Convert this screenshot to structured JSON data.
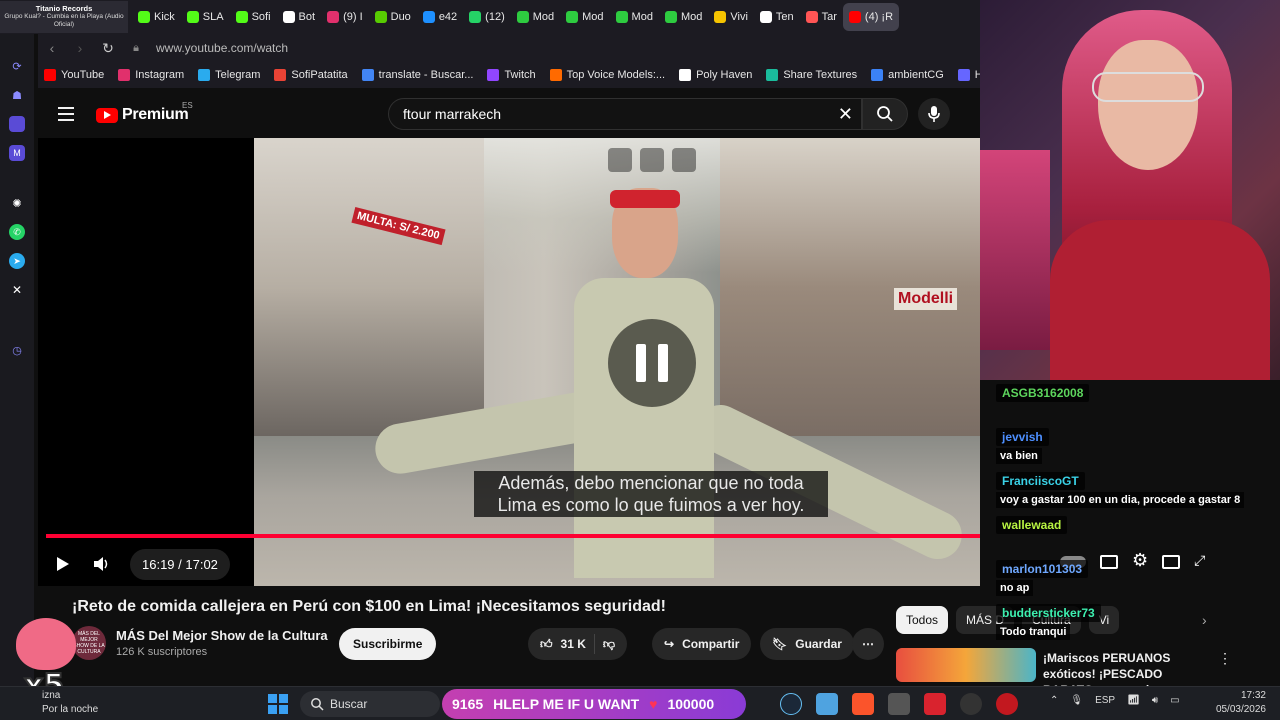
{
  "browser": {
    "first_tab": {
      "title": "Titanio Records",
      "subtitle": "Grupo Kual? - Cumbia en la Playa (Audio Oficial)"
    },
    "tabs": [
      {
        "label": "Kick",
        "color": "#53fc18"
      },
      {
        "label": "SLA",
        "color": "#53fc18"
      },
      {
        "label": "Sofi",
        "color": "#53fc18"
      },
      {
        "label": "Bot",
        "color": "#ffffff"
      },
      {
        "label": "(9) I",
        "color": "#e1306c"
      },
      {
        "label": "Duo",
        "color": "#58cc02"
      },
      {
        "label": "e42",
        "color": "#1e90ff"
      },
      {
        "label": "(12)",
        "color": "#25d366"
      },
      {
        "label": "Mod",
        "color": "#2ecc40"
      },
      {
        "label": "Mod",
        "color": "#2ecc40"
      },
      {
        "label": "Mod",
        "color": "#2ecc40"
      },
      {
        "label": "Mod",
        "color": "#2ecc40"
      },
      {
        "label": "Vivi",
        "color": "#f5c400"
      },
      {
        "label": "Ten",
        "color": "#ffffff"
      },
      {
        "label": "Tar",
        "color": "#ff5555"
      },
      {
        "label": "(4) ¡R",
        "color": "#ff0000"
      }
    ],
    "url": "www.youtube.com/watch",
    "bookmarks": [
      {
        "label": "YouTube",
        "color": "#ff0000"
      },
      {
        "label": "Instagram",
        "color": "#e1306c"
      },
      {
        "label": "Telegram",
        "color": "#2aabee"
      },
      {
        "label": "SofiPatatita",
        "color": "#ea4335"
      },
      {
        "label": "translate - Buscar...",
        "color": "#4285f4"
      },
      {
        "label": "Twitch",
        "color": "#9146ff"
      },
      {
        "label": "Top Voice Models:...",
        "color": "#ff6a00"
      },
      {
        "label": "Poly Haven",
        "color": "#ffffff"
      },
      {
        "label": "Share Textures",
        "color": "#1abc9c"
      },
      {
        "label": "ambientCG",
        "color": "#3b82f6"
      },
      {
        "label": "Ha",
        "color": "#6666ff"
      }
    ]
  },
  "youtube": {
    "logo": "Premium",
    "region": "ES",
    "search_value": "ftour marrakech",
    "player": {
      "subtitle_line1": "Además, debo mencionar que no toda",
      "subtitle_line2": "Lima es como lo que fuimos a ver hoy.",
      "sign_text": "MULTA: S/ 2.200",
      "store_sign": "Modelli",
      "time": "16:19 / 17:02",
      "progress": 0.958
    },
    "video_title": "¡Reto de comida callejera en Perú con $100 en Lima! ¡Necesitamos seguridad!",
    "channel": {
      "name": "MÁS Del Mejor Show de la Cultura",
      "subscribers": "126 K suscriptores",
      "avatar_text": "MÁS DEL MEJOR SHOW DE LA CULTURA",
      "subscribe_label": "Suscribirme"
    },
    "actions": {
      "likes": "31 K",
      "share": "Compartir",
      "save": "Guardar"
    },
    "chips": [
      "Todos",
      "MÁS D",
      "Cultura",
      "Vi"
    ],
    "recommendation": {
      "title": "¡Mariscos PERUANOS exóticos! ¡PESCADO BARATO vs caro de..."
    }
  },
  "chat": [
    {
      "user": "ASGB3162008",
      "color": "#5dd55d",
      "text": ""
    },
    {
      "user": "jevvish",
      "color": "#4d8fff",
      "text": "va bien"
    },
    {
      "user": "FranciiscoGT",
      "color": "#3ad1e6",
      "text": "voy a gastar 100 en un dia, procede a gastar 8"
    },
    {
      "user": "wallewaad",
      "color": "#b9f542",
      "text": ""
    },
    {
      "user": "marlon101303",
      "color": "#6fa8ff",
      "text": "no ap"
    },
    {
      "user": "buddersticker73",
      "color": "#3df0b0",
      "text": "Todo tranqui"
    }
  ],
  "sticker": {
    "text": "x5"
  },
  "taskbar": {
    "weather_title": "izna",
    "weather_sub": "Por la noche",
    "search_label": "Buscar",
    "banner_count": "9165",
    "banner_text": "HLELP ME IF U WANT",
    "banner_goal": "100000",
    "lang": "ESP",
    "time": "17:32",
    "date": "05/03/2026"
  }
}
